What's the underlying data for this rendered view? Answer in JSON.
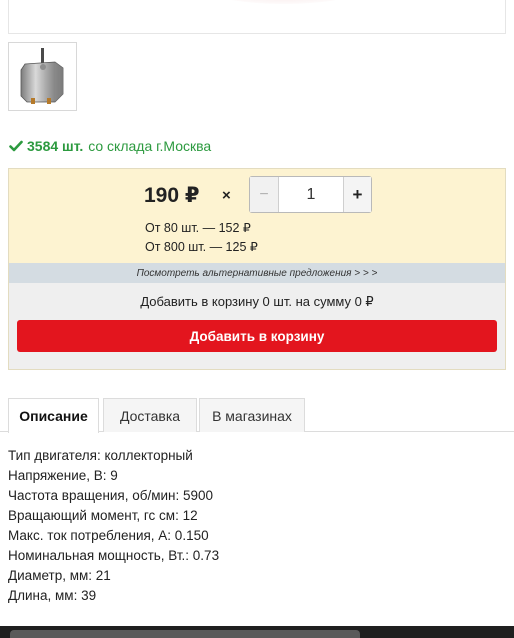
{
  "product": {
    "thumbnail_icon": "motor-thumbnail"
  },
  "stock": {
    "count": "3584 шт.",
    "location": "со склада г.Москва",
    "status_color": "#2c9a3f"
  },
  "pricing": {
    "price": "190 ₽",
    "multiply_sign": "×",
    "tiers": [
      "От 80 шт. — 152 ₽",
      "От 800 шт. — 125 ₽"
    ]
  },
  "quantity": {
    "minus_label": "−",
    "value": "1",
    "plus_label": "+"
  },
  "alternatives_link": "Посмотреть альтернативные предложения > > >",
  "cart": {
    "summary": "Добавить в корзину 0 шт. на сумму 0 ₽",
    "add_button_label": "Добавить в корзину",
    "accent_color": "#e3151e"
  },
  "tabs": [
    {
      "label": "Описание",
      "active": true
    },
    {
      "label": "Доставка",
      "active": false
    },
    {
      "label": "В магазинах",
      "active": false
    }
  ],
  "specs": [
    "Тип двигателя: коллекторный",
    "Напряжение, В: 9",
    "Частота вращения, об/мин: 5900",
    "Вращающий момент, гс см: 12",
    "Макс. ток потребления, А: 0.150",
    "Номинальная мощность, Вт.: 0.73",
    "Диаметр, мм: 21",
    "Длина, мм: 39"
  ]
}
